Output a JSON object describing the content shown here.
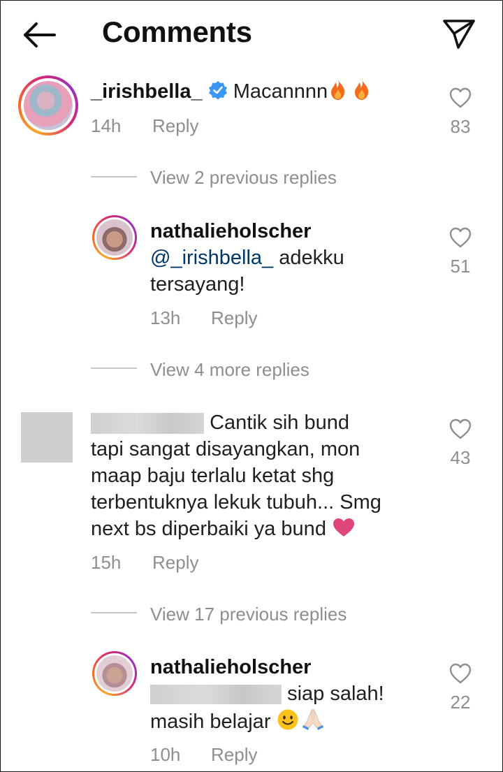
{
  "header": {
    "title": "Comments",
    "back_icon": "back-arrow-icon",
    "share_icon": "send-icon"
  },
  "comments": [
    {
      "username": "_irishbella_",
      "verified": true,
      "text": "Macannnn",
      "emoji": [
        "fire",
        "fire"
      ],
      "time": "14h",
      "reply_label": "Reply",
      "likes": "83",
      "view_replies": "View 2 previous replies"
    },
    {
      "username": "nathalieholscher",
      "mention": "@_irishbella_",
      "text_line1": " adekku",
      "text_line2": "tersayang!",
      "time": "13h",
      "reply_label": "Reply",
      "likes": "51",
      "view_replies": "View 4 more replies"
    },
    {
      "username_hidden": true,
      "text_line1": "Cantik sih bund",
      "text_line2": "tapi sangat disayangkan, mon",
      "text_line3": "maap baju terlalu ketat shg",
      "text_line4": "terbentuknya lekuk tubuh... Smg",
      "text_line5": "next bs diperbaiki ya bund",
      "emoji": [
        "heart"
      ],
      "time": "15h",
      "reply_label": "Reply",
      "likes": "43",
      "view_replies": "View 17 previous replies"
    },
    {
      "username": "nathalieholscher",
      "text_line1": "siap salah!",
      "text_line2": "masih belajar",
      "emoji": [
        "smile",
        "folded-hands"
      ],
      "time": "10h",
      "reply_label": "Reply",
      "likes": "22"
    }
  ],
  "colors": {
    "mention": "#00376b",
    "muted": "#8e8e8e",
    "verified": "#3897f0",
    "heart_emoji": "#e0457b"
  }
}
